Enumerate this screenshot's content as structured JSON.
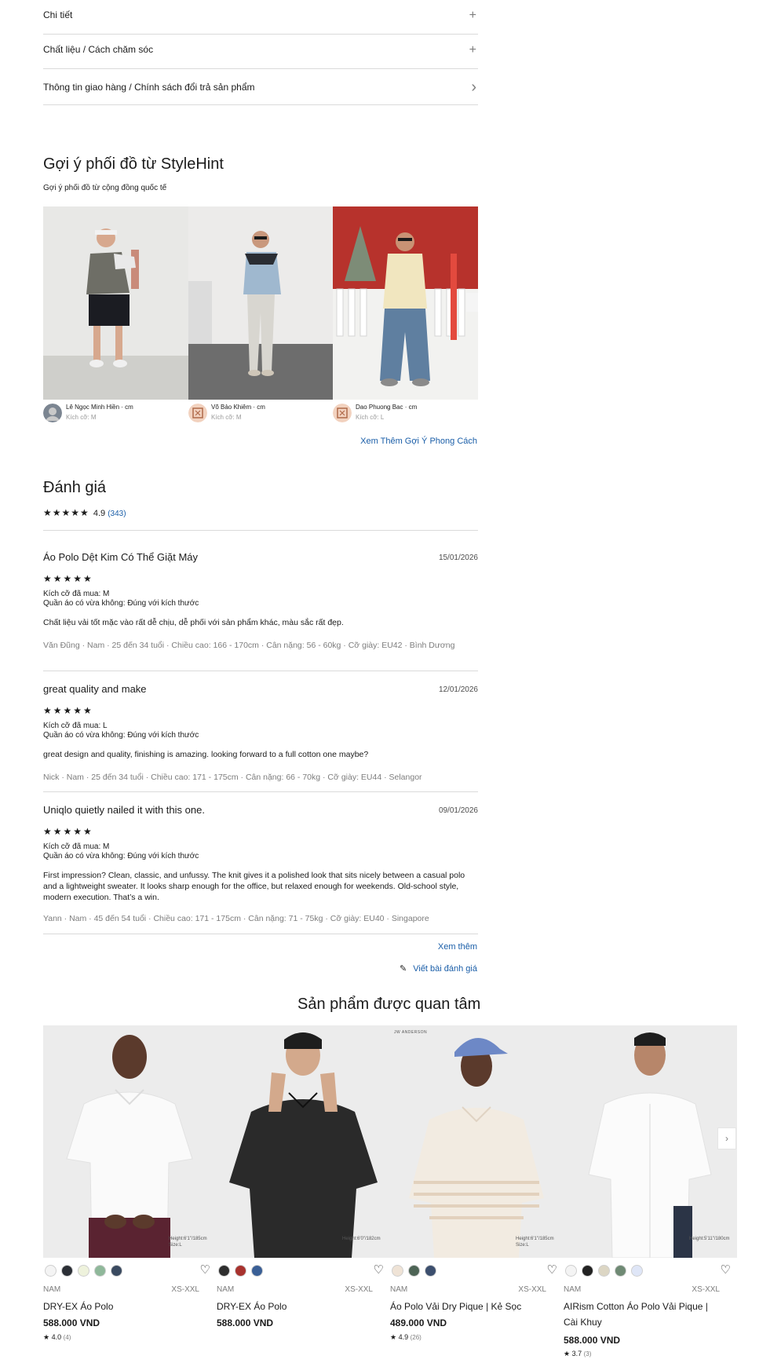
{
  "accordion": [
    {
      "label": "Chi tiết",
      "icon": "+"
    },
    {
      "label": "Chất liệu / Cách chăm sóc",
      "icon": "+"
    },
    {
      "label": "Thông tin giao hàng / Chính sách đổi trả sản phẩm",
      "icon": "›"
    }
  ],
  "stylehint": {
    "title": "Gợi ý phối đồ từ StyleHint",
    "subtitle": "Gợi ý phối đồ từ cộng đồng quốc tế",
    "creators": [
      {
        "name": "Lê Ngọc Minh Hiền · cm",
        "size": "Kích cỡ: M"
      },
      {
        "name": "Võ Bảo Khiêm · cm",
        "size": "Kích cỡ: M"
      },
      {
        "name": "Dao Phuong Bac · cm",
        "size": "Kích cỡ: L"
      }
    ],
    "more_link": "Xem Thêm Gợi Ý Phong Cách"
  },
  "reviews": {
    "title": "Đánh giá",
    "stars": "★★★★★",
    "average": "4.9",
    "count": "(343)",
    "items": [
      {
        "title": "Áo Polo Dệt Kim Có Thể Giặt Máy",
        "date": "15/01/2026",
        "stars": "★★★★★",
        "size_bought": "Kích cỡ đã mua: M",
        "fit": "Quần áo có vừa không: Đúng với kích thước",
        "body": "Chất liệu vải tốt mặc vào rất dễ chịu, dễ phối với sản phẩm khác, màu sắc rất đẹp.",
        "user": "Văn Đũng  ·  Nam  ·  25 đến 34 tuổi  ·  Chiều cao: 166 - 170cm  ·  Cân nặng: 56 - 60kg  ·  Cỡ giày: EU42  ·  Bình Dương"
      },
      {
        "title": "great quality and make",
        "date": "12/01/2026",
        "stars": "★★★★★",
        "size_bought": "Kích cỡ đã mua: L",
        "fit": "Quần áo có vừa không: Đúng với kích thước",
        "body": "great design and quality, finishing is amazing. looking forward to a full cotton one maybe?",
        "user": "Nick  ·  Nam  ·  25 đến 34 tuổi  ·  Chiều cao: 171 - 175cm  ·  Cân nặng: 66 - 70kg  ·  Cỡ giày: EU44  ·  Selangor"
      },
      {
        "title": "Uniqlo quietly nailed it with this one.",
        "date": "09/01/2026",
        "stars": "★★★★★",
        "size_bought": "Kích cỡ đã mua: M",
        "fit": "Quần áo có vừa không: Đúng với kích thước",
        "body": "First impression? Clean, classic, and unfussy. The knit gives it a polished look that sits nicely between a casual polo and a lightweight sweater. It looks sharp enough for the office, but relaxed enough for weekends. Old-school style, modern execution. That’s a win.",
        "user": "Yann  ·  Nam  ·  45 đến 54 tuổi  ·  Chiều cao: 171 - 175cm  ·  Cân nặng: 71 - 75kg  ·  Cỡ giày: EU40  ·  Singapore"
      }
    ],
    "more_link": "Xem thêm",
    "write_link": "Viết bài đánh giá"
  },
  "related": {
    "title": "Sản phẩm được quan tâm",
    "products": [
      {
        "gender": "NAM",
        "sizes": "XS-XXL",
        "name": "DRY-EX Áo Polo",
        "price": "588.000 VND",
        "rating": "4.0",
        "rating_count": "(4)",
        "model_info": "Height:6'1\"/185cm  Size:L",
        "swatches": [
          "#f4f4f4",
          "#2b2f36",
          "#eef2dc",
          "#8fb89a",
          "#3a4a60"
        ]
      },
      {
        "gender": "NAM",
        "sizes": "XS-XXL",
        "name": "DRY-EX Áo Polo",
        "price": "588.000 VND",
        "rating": "",
        "rating_count": "",
        "model_info": "Height:6'0\"/182cm",
        "swatches": [
          "#2e2e2e",
          "#a8322e",
          "#3a5f96"
        ]
      },
      {
        "gender": "NAM",
        "sizes": "XS-XXL",
        "name": "Áo Polo Vải Dry Pique | Kẻ Sọc",
        "price": "489.000 VND",
        "rating": "4.9",
        "rating_count": "(26)",
        "model_info": "Height:6'1\"/185cm  Size:L",
        "brand_mark": "JW ANDERSON",
        "swatches": [
          "#efe3d6",
          "#4d6455",
          "#3c4f6e"
        ]
      },
      {
        "gender": "NAM",
        "sizes": "XS-XXL",
        "name": "AIRism Cotton Áo Polo Vải Pique | Cài Khuy",
        "price": "588.000 VND",
        "rating": "3.7",
        "rating_count": "(3)",
        "model_info": "Height:5'11\"/180cm",
        "swatches": [
          "#f4f4f4",
          "#222222",
          "#dcd6c4",
          "#6f8a74",
          "#dfe6f7"
        ]
      }
    ]
  }
}
